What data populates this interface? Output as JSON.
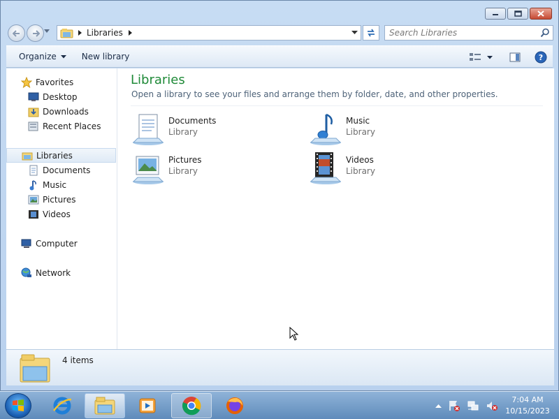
{
  "window": {
    "controls": {
      "minimize": "minimize",
      "maximize": "maximize",
      "close": "close"
    }
  },
  "address": {
    "crumb": "Libraries",
    "search_placeholder": "Search Libraries"
  },
  "toolbar": {
    "organize_label": "Organize",
    "new_library_label": "New library"
  },
  "sidebar": {
    "favorites": {
      "label": "Favorites",
      "items": [
        {
          "label": "Desktop",
          "icon": "desktop-icon"
        },
        {
          "label": "Downloads",
          "icon": "downloads-icon"
        },
        {
          "label": "Recent Places",
          "icon": "recent-places-icon"
        }
      ]
    },
    "libraries": {
      "label": "Libraries",
      "items": [
        {
          "label": "Documents",
          "icon": "documents-icon"
        },
        {
          "label": "Music",
          "icon": "music-icon"
        },
        {
          "label": "Pictures",
          "icon": "pictures-icon"
        },
        {
          "label": "Videos",
          "icon": "videos-icon"
        }
      ]
    },
    "computer": {
      "label": "Computer"
    },
    "network": {
      "label": "Network"
    }
  },
  "main": {
    "title": "Libraries",
    "description": "Open a library to see your files and arrange them by folder, date, and other properties.",
    "libraries": [
      {
        "name": "Documents",
        "type": "Library",
        "icon": "documents-library-icon"
      },
      {
        "name": "Music",
        "type": "Library",
        "icon": "music-library-icon"
      },
      {
        "name": "Pictures",
        "type": "Library",
        "icon": "pictures-library-icon"
      },
      {
        "name": "Videos",
        "type": "Library",
        "icon": "videos-library-icon"
      }
    ]
  },
  "details": {
    "count": "4 items"
  },
  "taskbar": {
    "apps": [
      "internet-explorer-icon",
      "windows-explorer-icon",
      "media-player-icon",
      "chrome-icon",
      "firefox-icon"
    ],
    "clock": {
      "time": "7:04 AM",
      "date": "10/15/2023"
    }
  },
  "colors": {
    "title_green": "#1f8a38",
    "window_frame": "#b9d1ee",
    "taskbar": "#5f8bbb"
  }
}
